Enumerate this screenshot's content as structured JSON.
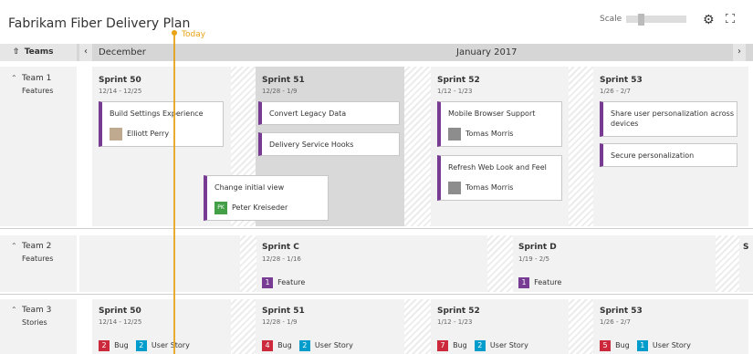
{
  "header": {
    "title": "Fabrikam Fiber Delivery Plan",
    "scale_label": "Scale",
    "settings_icon": "gear-icon",
    "fullscreen_icon": "fullscreen-icon"
  },
  "today_label": "Today",
  "timeline": {
    "teams_label": "Teams",
    "months": [
      "December",
      "January 2017"
    ]
  },
  "teams": [
    {
      "name": "Team 1",
      "type": "Features",
      "sprints": [
        {
          "name": "Sprint 50",
          "dates": "12/14 - 12/25"
        },
        {
          "name": "Sprint 51",
          "dates": "12/28 - 1/9"
        },
        {
          "name": "Sprint 52",
          "dates": "1/12 - 1/23"
        },
        {
          "name": "Sprint 53",
          "dates": "1/26 - 2/7"
        }
      ],
      "cards": [
        {
          "title": "Build Settings Experience",
          "person": "Elliott Perry"
        },
        {
          "title": "Convert Legacy Data"
        },
        {
          "title": "Delivery Service Hooks"
        },
        {
          "title": "Change initial view",
          "person": "Peter Kreiseder",
          "initials": "PK"
        },
        {
          "title": "Mobile Browser Support",
          "person": "Tomas Morris"
        },
        {
          "title": "Refresh Web Look and Feel",
          "person": "Tomas Morris"
        },
        {
          "title": "Share user personalization across devices"
        },
        {
          "title": "Secure personalization"
        }
      ]
    },
    {
      "name": "Team 2",
      "type": "Features",
      "sprints": [
        {
          "name": "Sprint C",
          "dates": "12/28 - 1/16",
          "count": "1",
          "label": "Feature"
        },
        {
          "name": "Sprint D",
          "dates": "1/19 - 2/5",
          "count": "1",
          "label": "Feature"
        },
        {
          "name": "S"
        }
      ]
    },
    {
      "name": "Team 3",
      "type": "Stories",
      "sprints": [
        {
          "name": "Sprint 50",
          "dates": "12/14 - 12/25",
          "bugs": "2",
          "stories": "2"
        },
        {
          "name": "Sprint 51",
          "dates": "12/28 - 1/9",
          "bugs": "4",
          "stories": "2"
        },
        {
          "name": "Sprint 52",
          "dates": "1/12 - 1/23",
          "bugs": "7",
          "stories": "2"
        },
        {
          "name": "Sprint 53",
          "dates": "1/26 - 2/7",
          "bugs": "5",
          "stories": "1"
        }
      ],
      "bug_label": "Bug",
      "story_label": "User Story"
    }
  ]
}
